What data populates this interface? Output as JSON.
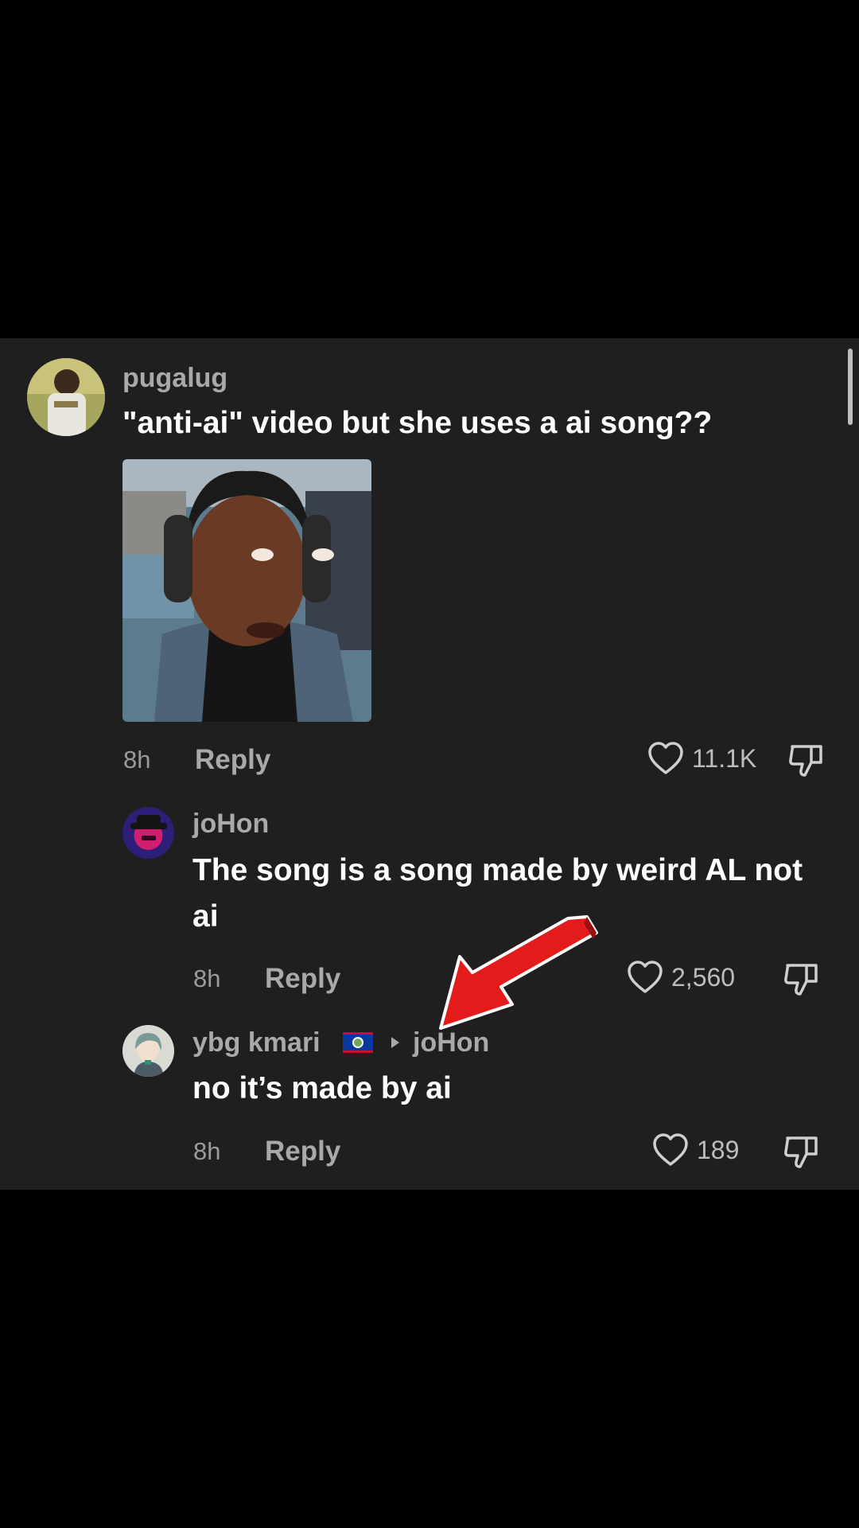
{
  "comments": [
    {
      "username": "pugalug",
      "text": "\"anti-ai\" video but she uses a ai song??",
      "time": "8h",
      "reply_label": "Reply",
      "likes": "11.1K",
      "avatar_icon": "user-avatar-photo",
      "attachment": "attached-photo-person-with-headphones"
    },
    {
      "username": "joHon",
      "text": "The song is a song made by weird AL not ai",
      "time": "8h",
      "reply_label": "Reply",
      "likes": "2,560",
      "avatar_icon": "cartoon-avatar-purple"
    },
    {
      "username": "ybg kmari",
      "flag_icon": "belize-flag-icon",
      "reply_to": "joHon",
      "text": "no it’s made by ai",
      "time": "8h",
      "reply_label": "Reply",
      "likes": "189",
      "avatar_icon": "anime-avatar"
    }
  ],
  "annotation": {
    "arrow_icon": "red-arrow-icon",
    "arrow_color": "#e41b1b"
  },
  "colors": {
    "panel_bg": "#1f1f1f",
    "username": "#a9a9a9",
    "text": "#ffffff"
  }
}
